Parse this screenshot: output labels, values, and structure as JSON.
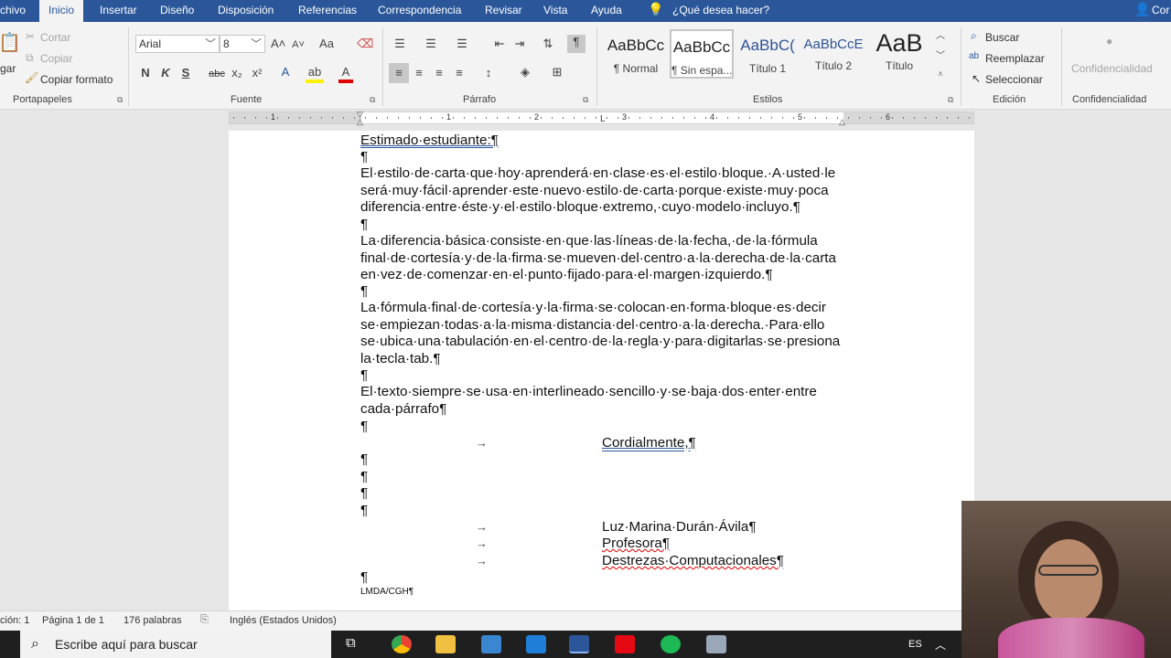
{
  "tabs": [
    "chivo",
    "Inicio",
    "Insertar",
    "Diseño",
    "Disposición",
    "Referencias",
    "Correspondencia",
    "Revisar",
    "Vista",
    "Ayuda"
  ],
  "tell_me": "¿Qué desea hacer?",
  "account_label": "Cor",
  "clipboard": {
    "paste": "gar",
    "cut": "Cortar",
    "copy": "Copiar",
    "format_painter": "Copiar formato",
    "label": "Portapapeles"
  },
  "font": {
    "name": "Arial",
    "size": "8",
    "bold": "N",
    "italic": "K",
    "underline": "S",
    "strike": "abc",
    "sub": "x₂",
    "sup": "x²",
    "case": "Aa",
    "label": "Fuente"
  },
  "paragraph": {
    "label": "Párrafo",
    "pilcrow": "¶"
  },
  "styles": {
    "items": [
      {
        "sample": "AaBbCc",
        "label": "¶ Normal"
      },
      {
        "sample": "AaBbCc",
        "label": "¶ Sin espa..."
      },
      {
        "sample": "AaBbC(",
        "label": "Título 1"
      },
      {
        "sample": "AaBbCcE",
        "label": "Título 2"
      },
      {
        "sample": "AaB",
        "label": "Título"
      }
    ],
    "label": "Estilos"
  },
  "editing": {
    "find": "Buscar",
    "replace": "Reemplazar",
    "select": "Seleccionar",
    "label": "Edición"
  },
  "confidentiality": {
    "button": "Confidencialidad",
    "label": "Confidencialidad"
  },
  "ruler": {
    "numbers": [
      "1",
      "1",
      "2",
      "3",
      "4",
      "5",
      "6"
    ]
  },
  "document": {
    "greeting": "Estimado·estudiante:¶",
    "pilcrow": "¶",
    "p1": [
      "El·estilo·de·carta·que·hoy·aprenderá·en·clase·es·el·estilo·bloque.·A·usted·le",
      "será·muy·fácil·aprender·este·nuevo·estilo·de·carta·porque·existe·muy·poca",
      "diferencia·entre·éste·y·el·estilo·bloque·extremo,·cuyo·modelo·incluyo.¶"
    ],
    "p2": [
      "La·diferencia·básica·consiste·en·que·las·líneas·de·la·fecha,·de·la·fórmula",
      "final·de·cortesía·y·de·la·firma·se·mueven·del·centro·a·la·derecha·de·la·carta",
      "en·vez·de·comenzar·en·el·punto·fijado·para·el·margen·izquierdo.¶"
    ],
    "p3": [
      "La·fórmula·final·de·cortesía·y·la·firma·se·colocan·en·forma·bloque·es·decir",
      "se·empiezan·todas·a·la·misma·distancia·del·centro·a·la·derecha.·Para·ello",
      "se·ubica·una·tabulación·en·el·centro·de·la·regla·y·para·digitarlas·se·presiona",
      "la·tecla·tab.¶"
    ],
    "p4": [
      "El·texto·siempre·se·usa·en·interlineado·sencillo·y·se·baja·dos·enter·entre",
      "cada·párrafo¶"
    ],
    "closing": "Cordialmente,¶",
    "signer": "Luz·Marina·Durán·Ávila¶",
    "title": "Profesora¶",
    "department": "Destrezas·Computacionales¶",
    "initials": "LMDA/CGH¶",
    "tab_arrow": "→"
  },
  "status": {
    "section": "ción: 1",
    "page": "Página 1 de 1",
    "words": "176 palabras",
    "language": "Inglés (Estados Unidos)"
  },
  "taskbar": {
    "search_placeholder": "Escribe aquí para buscar",
    "lang": "ES"
  }
}
